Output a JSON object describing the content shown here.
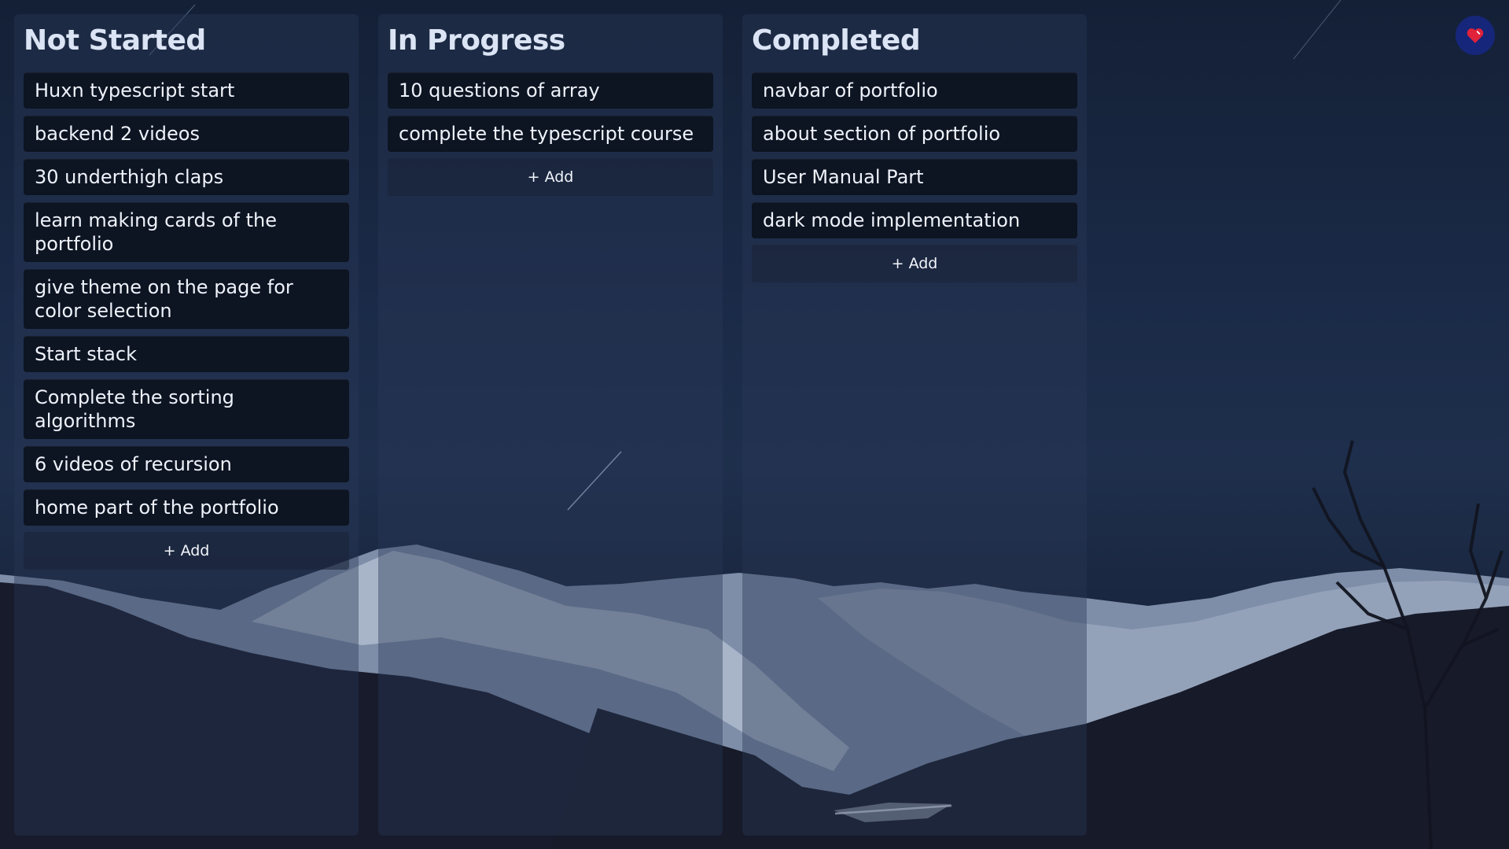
{
  "columns": [
    {
      "title": "Not Started",
      "cards": [
        "Huxn typescript start",
        "backend 2 videos",
        "30 underthigh claps",
        "learn making cards of the portfolio",
        "give theme on the page for color selection",
        "Start stack",
        "Complete the sorting algorithms",
        "6 videos of recursion",
        "home part of the portfolio"
      ],
      "add_label": "+ Add"
    },
    {
      "title": "In Progress",
      "cards": [
        "10 questions of array",
        "complete the typescript course"
      ],
      "add_label": "+ Add"
    },
    {
      "title": "Completed",
      "cards": [
        "navbar of portfolio",
        "about section of portfolio",
        "User Manual Part",
        "dark mode implementation"
      ],
      "add_label": "+ Add"
    }
  ],
  "theme_toggle": {
    "icon": "heart-icon",
    "color": "#e0223b",
    "background": "#16267a"
  },
  "colors": {
    "card_bg": "#0d1422",
    "card_text": "#eef2fa",
    "title_text": "#dbe4f4"
  }
}
